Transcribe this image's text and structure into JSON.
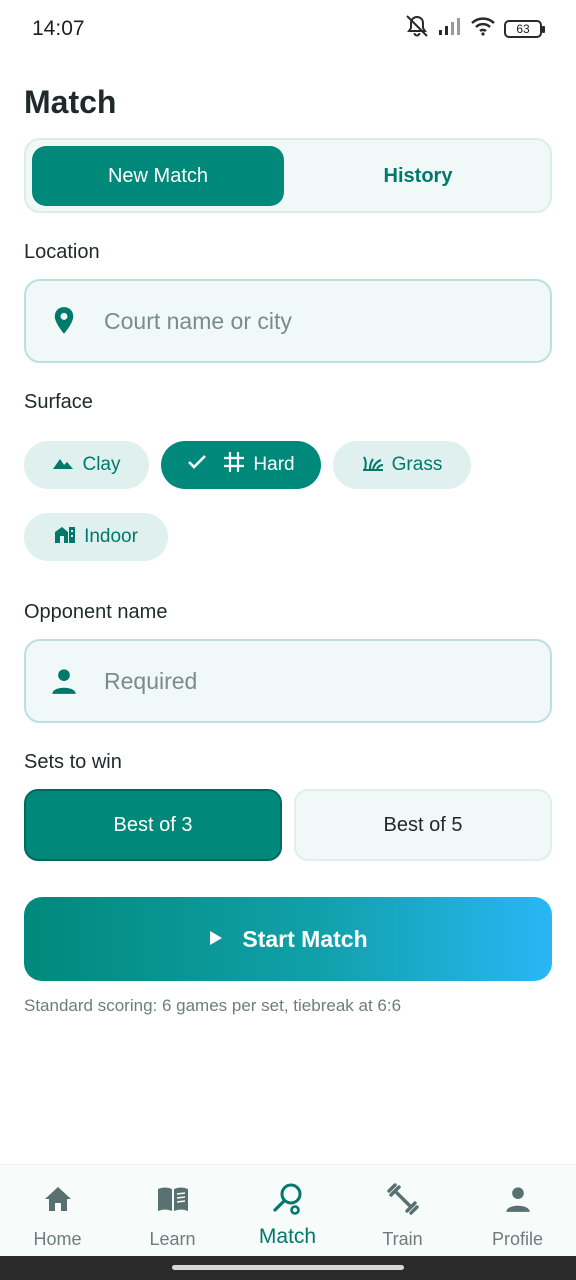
{
  "status_bar": {
    "time": "14:07",
    "battery": "63"
  },
  "page": {
    "title": "Match"
  },
  "tabs": [
    {
      "label": "New Match",
      "active": true
    },
    {
      "label": "History",
      "active": false
    }
  ],
  "location": {
    "label": "Location",
    "placeholder": "Court name or city",
    "value": "",
    "icon": "location-pin-icon"
  },
  "surface": {
    "label": "Surface",
    "options": [
      {
        "label": "Clay",
        "icon": "mountain-icon",
        "selected": false
      },
      {
        "label": "Hard",
        "icon": "grid-icon",
        "selected": true
      },
      {
        "label": "Grass",
        "icon": "grass-icon",
        "selected": false
      },
      {
        "label": "Indoor",
        "icon": "building-icon",
        "selected": false
      }
    ]
  },
  "opponent": {
    "label": "Opponent name",
    "placeholder": "Required",
    "value": "",
    "icon": "person-icon"
  },
  "sets": {
    "label": "Sets to win",
    "options": [
      {
        "label": "Best of 3",
        "selected": true
      },
      {
        "label": "Best of 5",
        "selected": false
      }
    ]
  },
  "start_button": {
    "label": "Start Match",
    "icon": "play-icon"
  },
  "hint": "Standard scoring: 6 games per set, tiebreak at 6:6",
  "bottom_nav": [
    {
      "label": "Home",
      "icon": "home-icon",
      "active": false
    },
    {
      "label": "Learn",
      "icon": "book-icon",
      "active": false
    },
    {
      "label": "Match",
      "icon": "racket-icon",
      "active": true
    },
    {
      "label": "Train",
      "icon": "dumbbell-icon",
      "active": false
    },
    {
      "label": "Profile",
      "icon": "person-icon",
      "active": false
    }
  ],
  "colors": {
    "primary": "#00897b",
    "primary_dark": "#00796b",
    "accent_gradient_end": "#29b6f6",
    "surface_tint": "#f1f8f8"
  }
}
